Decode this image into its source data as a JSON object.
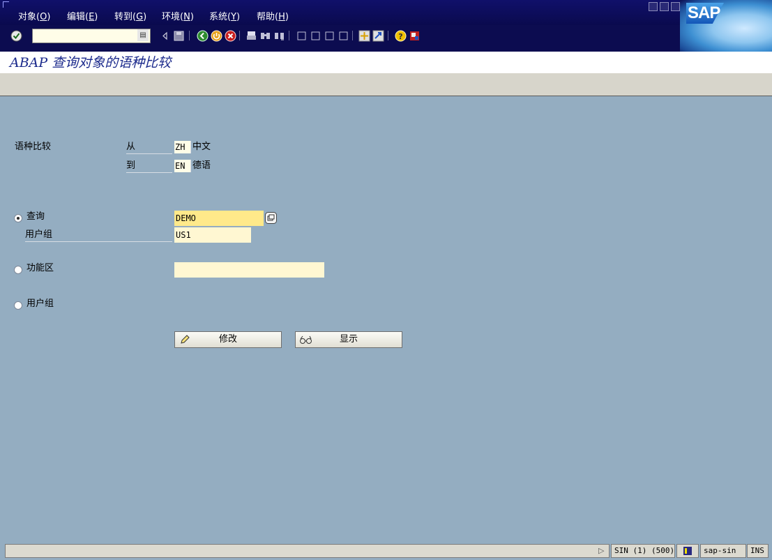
{
  "menu": [
    {
      "label": "对象(",
      "key": "O",
      "end": ")"
    },
    {
      "label": "编辑(",
      "key": "E",
      "end": ")"
    },
    {
      "label": "转到(",
      "key": "G",
      "end": ")"
    },
    {
      "label": "环境(",
      "key": "N",
      "end": ")"
    },
    {
      "label": "系统(",
      "key": "Y",
      "end": ")"
    },
    {
      "label": "帮助(",
      "key": "H",
      "end": ")"
    }
  ],
  "brand": {
    "logo_text": "SAP"
  },
  "toolbar": {
    "command_field_value": ""
  },
  "page": {
    "title": "ABAP 查询对象的语种比较"
  },
  "language_compare": {
    "label": "语种比较",
    "from_label": "从",
    "from_code": "ZH",
    "from_name": "中文",
    "to_label": "到",
    "to_code": "EN",
    "to_name": "德语"
  },
  "options": {
    "query": {
      "label": "查询",
      "value": "DEMO",
      "selected": true
    },
    "user_group_sub": {
      "label": "用户组",
      "value": "US1"
    },
    "functional_area": {
      "label": "功能区",
      "value": ""
    },
    "user_group": {
      "label": "用户组"
    }
  },
  "buttons": {
    "change": "修改",
    "display": "显示"
  },
  "status": {
    "message": "",
    "system": "SIN (1) (500)",
    "server": "sap-sin",
    "mode": "INS"
  },
  "colors": {
    "menubar": "#0c0c50",
    "background": "#94adc1",
    "title_text": "#1b2a8c",
    "input_bg": "#fff7d2"
  },
  "icons": [
    "enter-icon",
    "save-icon",
    "back-icon",
    "exit-icon",
    "cancel-icon",
    "print-icon",
    "find-icon",
    "find-next-icon",
    "first-page-icon",
    "prev-page-icon",
    "next-page-icon",
    "last-page-icon",
    "create-session-icon",
    "shortcut-icon",
    "help-icon",
    "customize-icon",
    "pencil-icon",
    "glasses-icon"
  ]
}
